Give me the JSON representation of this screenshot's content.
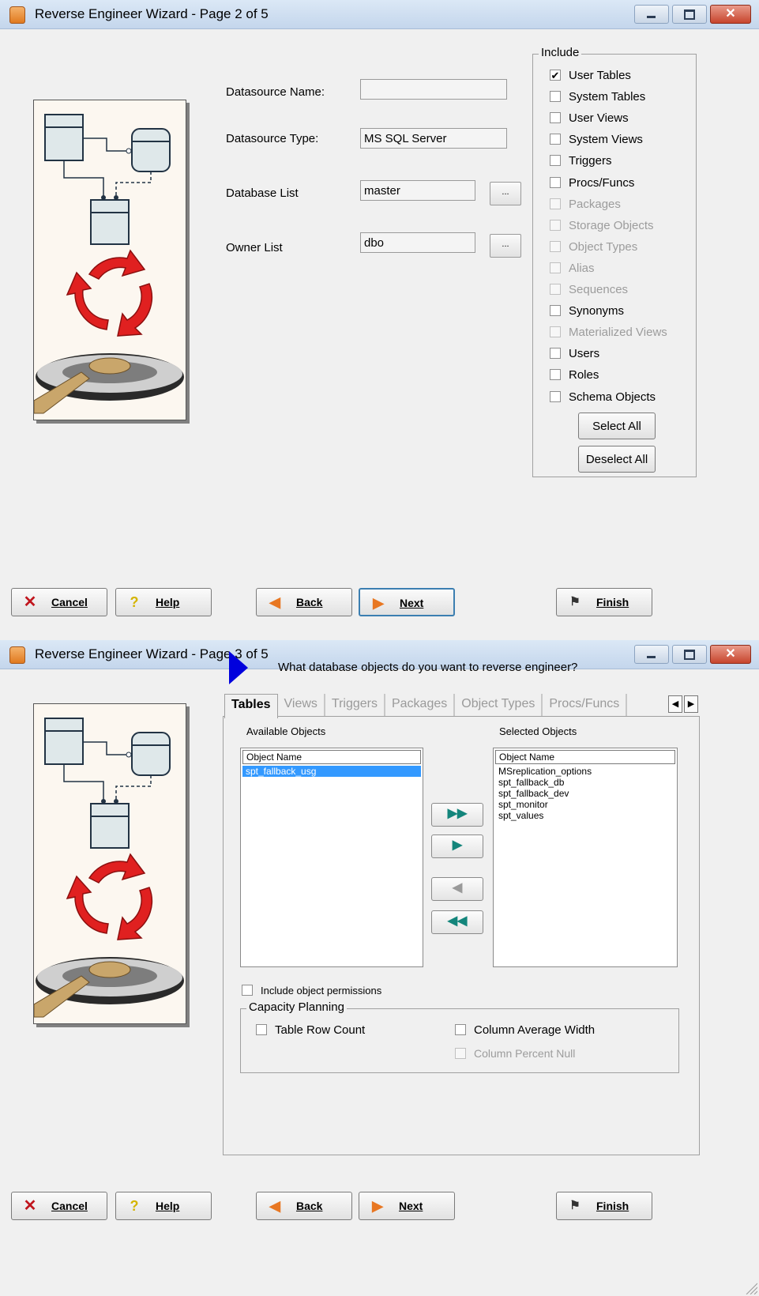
{
  "page2": {
    "title": "Reverse Engineer Wizard - Page 2 of 5",
    "fields": {
      "datasource_name": {
        "label": "Datasource Name:",
        "value": ""
      },
      "datasource_type": {
        "label": "Datasource Type:",
        "value": "MS SQL Server"
      },
      "database_list": {
        "label": "Database List",
        "value": "master",
        "button": "..."
      },
      "owner_list": {
        "label": "Owner List",
        "value": "dbo",
        "button": "..."
      }
    },
    "include": {
      "legend": "Include",
      "items": [
        {
          "label": "User Tables",
          "checked": true,
          "enabled": true
        },
        {
          "label": "System Tables",
          "checked": false,
          "enabled": true
        },
        {
          "label": "User Views",
          "checked": false,
          "enabled": true
        },
        {
          "label": "System Views",
          "checked": false,
          "enabled": true
        },
        {
          "label": "Triggers",
          "checked": false,
          "enabled": true
        },
        {
          "label": "Procs/Funcs",
          "checked": false,
          "enabled": true
        },
        {
          "label": "Packages",
          "checked": false,
          "enabled": false
        },
        {
          "label": "Storage Objects",
          "checked": false,
          "enabled": false
        },
        {
          "label": "Object Types",
          "checked": false,
          "enabled": false
        },
        {
          "label": "Alias",
          "checked": false,
          "enabled": false
        },
        {
          "label": "Sequences",
          "checked": false,
          "enabled": false
        },
        {
          "label": "Synonyms",
          "checked": false,
          "enabled": true
        },
        {
          "label": "Materialized Views",
          "checked": false,
          "enabled": false
        },
        {
          "label": "Users",
          "checked": false,
          "enabled": true
        },
        {
          "label": "Roles",
          "checked": false,
          "enabled": true
        },
        {
          "label": "Schema Objects",
          "checked": false,
          "enabled": true
        }
      ],
      "check_mark": "✔",
      "select_all": "Select All",
      "deselect_all": "Deselect All"
    }
  },
  "page3": {
    "title": "Reverse Engineer Wizard - Page 3 of 5",
    "question": "What database objects do you want to reverse engineer?",
    "tabs": [
      "Tables",
      "Views",
      "Triggers",
      "Packages",
      "Object Types",
      "Procs/Funcs"
    ],
    "active_tab": "Tables",
    "available": {
      "label": "Available Objects",
      "header": "Object Name",
      "items": [
        "spt_fallback_usg"
      ],
      "selected_index": 0
    },
    "selected": {
      "label": "Selected Objects",
      "header": "Object Name",
      "items": [
        "MSreplication_options",
        "spt_fallback_db",
        "spt_fallback_dev",
        "spt_monitor",
        "spt_values"
      ]
    },
    "move_buttons": {
      "add_all": "▶▶",
      "add": "▶",
      "remove": "◀",
      "remove_all": "◀◀"
    },
    "include_permissions": "Include object permissions",
    "capacity": {
      "legend": "Capacity Planning",
      "table_row_count": "Table Row Count",
      "column_average_width": "Column Average Width",
      "column_percent_null": "Column Percent Null"
    }
  },
  "nav": {
    "cancel": "Cancel",
    "help": "Help",
    "back": "Back",
    "next": "Next",
    "finish": "Finish"
  },
  "icons": {
    "cancel": "x-icon",
    "help": "question-icon",
    "back": "arrow-left-icon",
    "next": "arrow-right-icon",
    "finish": "checkered-flag-icon"
  },
  "colors": {
    "title_bar": "#c4d6ec",
    "selection": "#3399ff",
    "accent_orange": "#e87722",
    "move_arrow": "#13857b"
  }
}
